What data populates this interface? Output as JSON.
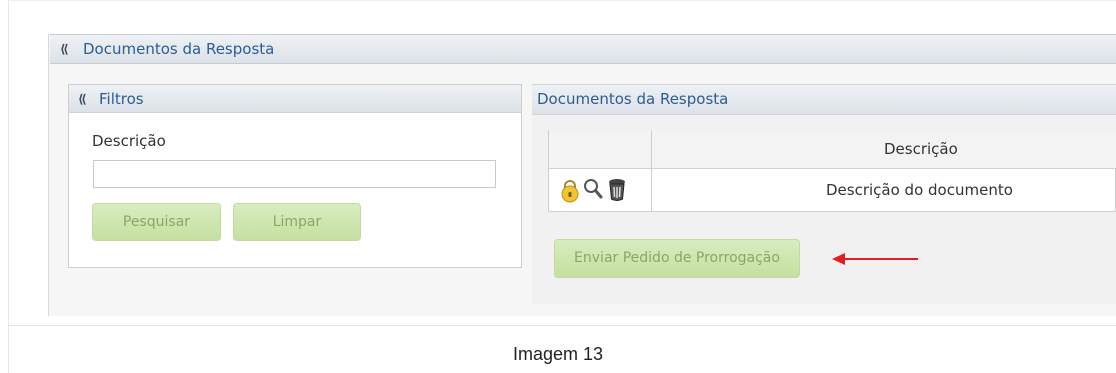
{
  "section": {
    "title": "Documentos da Resposta"
  },
  "filters": {
    "title": "Filtros",
    "description_label": "Descrição",
    "description_value": "",
    "search_button": "Pesquisar",
    "clear_button": "Limpar"
  },
  "documents": {
    "title": "Documentos da Resposta",
    "columns": [
      "",
      "Descrição"
    ],
    "rows": [
      {
        "icons": [
          "lock-icon",
          "magnifier-icon",
          "trash-icon"
        ],
        "description": "Descrição do documento"
      }
    ],
    "extension_button": "Enviar Pedido de Prorrogação"
  },
  "caption": "Imagem 13",
  "colors": {
    "header_text": "#2b5d94",
    "button_bg": "#c4e0a0",
    "button_text": "#8aa864",
    "arrow": "#e02020"
  }
}
